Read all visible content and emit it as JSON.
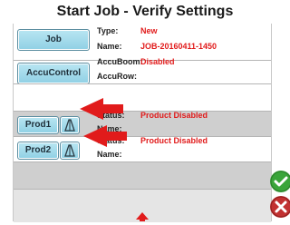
{
  "title": "Start Job - Verify Settings",
  "job": {
    "button": "Job",
    "type_label": "Type:",
    "type_value": "New",
    "name_label": "Name:",
    "name_value": "JOB-20160411-1450"
  },
  "accu": {
    "button": "AccuControl",
    "boom_label": "AccuBoom:",
    "boom_value": "Disabled",
    "row_label": "AccuRow:"
  },
  "products": [
    {
      "button": "Prod1",
      "status_label": "Status:",
      "status_value": "Product Disabled",
      "name_label": "Name:"
    },
    {
      "button": "Prod2",
      "status_label": "Status:",
      "status_value": "Product Disabled",
      "name_label": "Name:"
    }
  ],
  "icons": {
    "confirm": "check-icon",
    "cancel": "close-icon",
    "product": "funnel-icon",
    "arrow": "red-arrow-icon"
  },
  "colors": {
    "accent": "#e11b1b",
    "button": "#a3dcec",
    "confirm": "#3aa53a",
    "cancel": "#c23131"
  }
}
